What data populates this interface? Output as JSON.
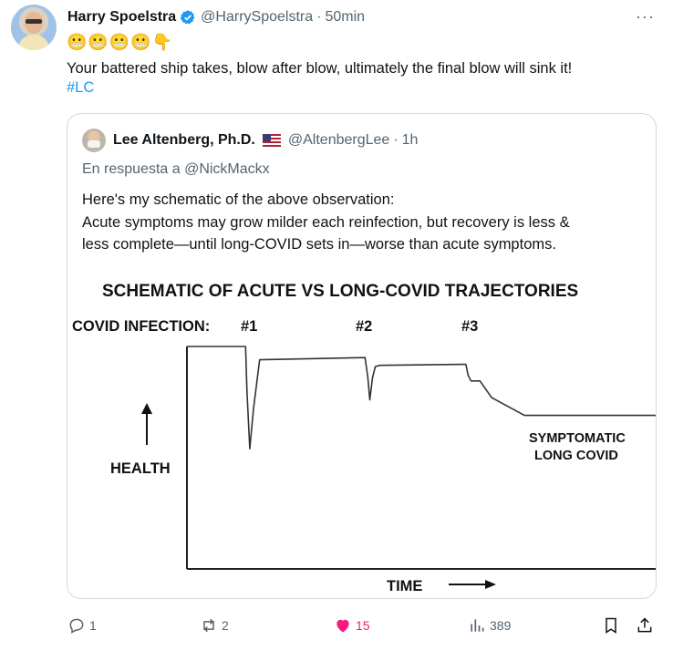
{
  "tweet": {
    "author_name": "Harry Spoelstra",
    "author_handle": "@HarrySpoelstra",
    "separator": "·",
    "time": "50min",
    "more": "···",
    "emojis": "😬😬😬😬👇",
    "text": "Your battered ship takes, blow after blow, ultimately the final blow will sink it!",
    "hashtag": "#LC"
  },
  "quote": {
    "author_name": "Lee Altenberg, Ph.D.",
    "author_handle": "@AltenbergLee",
    "separator": "·",
    "time": "1h",
    "reply_to": "En respuesta a @NickMackx",
    "lines": [
      "Here's my schematic of the above observation:",
      "Acute symptoms may grow milder each reinfection, but recovery is less &",
      "less complete—until long-COVID sets in—worse than acute symptoms."
    ]
  },
  "chart_data": {
    "type": "line",
    "title": "SCHEMATIC OF ACUTE VS LONG-COVID TRAJECTORIES",
    "infection_prefix": "COVID INFECTION:",
    "infection_labels": [
      "#1",
      "#2",
      "#3"
    ],
    "ylabel": "HEALTH",
    "xlabel": "TIME",
    "annotation_line1": "SYMPTOMATIC",
    "annotation_line2": "LONG COVID",
    "xlim": [
      0,
      100
    ],
    "ylim": [
      0,
      100
    ],
    "series": [
      {
        "x": [
          0,
          12.5,
          12.8,
          13.4,
          14.2,
          15.5,
          38.0,
          38.6,
          39.0,
          39.6,
          40.2,
          41.2,
          59.5,
          60.0,
          60.6,
          62.5,
          65.0,
          72.0,
          100
        ],
        "y": [
          100,
          100,
          80,
          54,
          72,
          94,
          95,
          86,
          76,
          86,
          91,
          91.5,
          92,
          87,
          84.5,
          84.5,
          77,
          69,
          69
        ]
      }
    ]
  },
  "actions": {
    "replies": "1",
    "reposts": "2",
    "likes": "15",
    "views": "389"
  },
  "colors": {
    "link": "#1d9bf0",
    "secondary_text": "#536471",
    "like": "#f91880",
    "border": "#cfd9de"
  }
}
